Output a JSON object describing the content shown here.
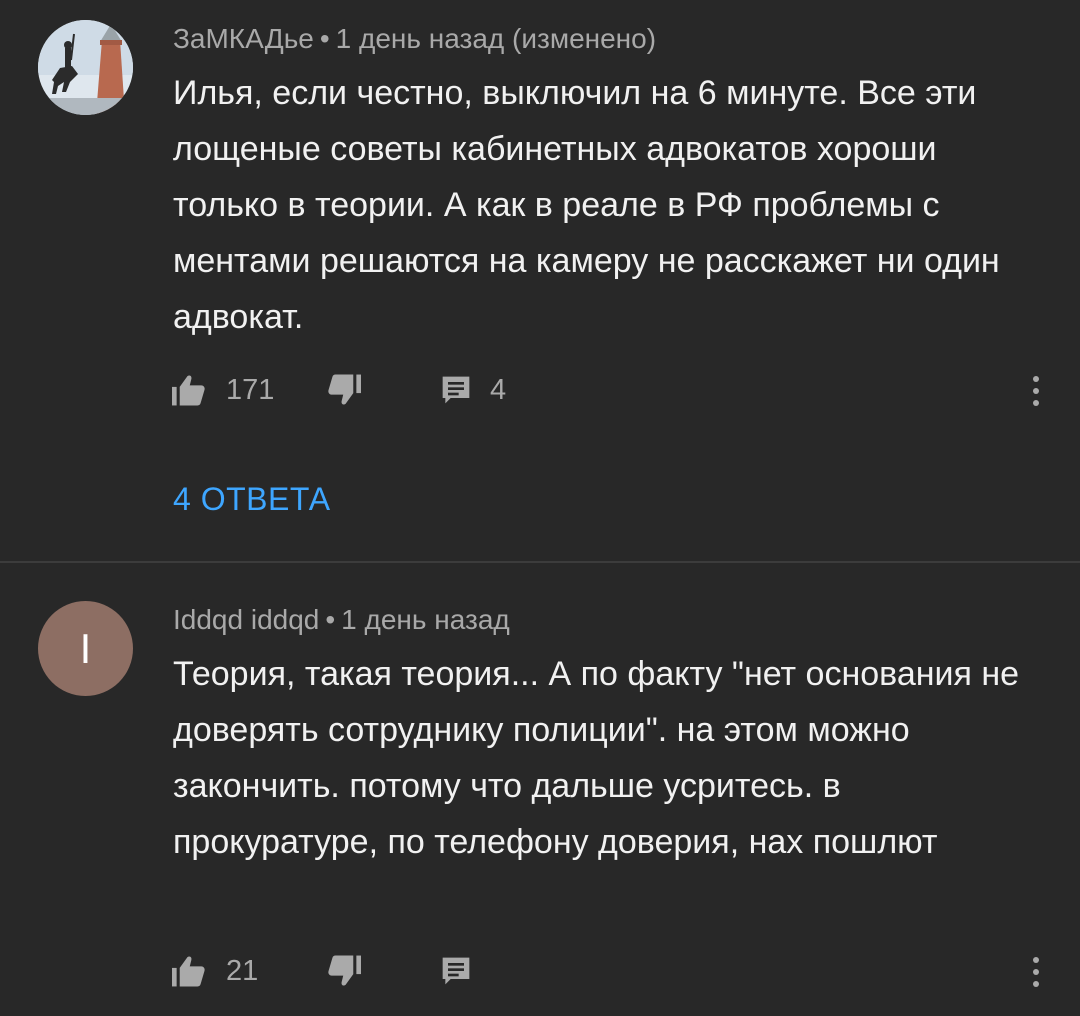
{
  "comments": [
    {
      "author": "ЗаМКАДье",
      "separator": "•",
      "time": "1 день назад (изменено)",
      "text": "Илья, если честно, выключил на 6 минуте. Все эти лощеные советы кабинетных адвокатов хороши только в теории. А как в реале в РФ проблемы с ментами решаются на камеру не расскажет ни один адвокат.",
      "likes": "171",
      "reply_count": "4",
      "replies_link": "4 ОТВЕТА",
      "avatar_icon": "monument-photo"
    },
    {
      "author": "Iddqd iddqd",
      "separator": "•",
      "time": "1 день назад",
      "text": "Теория, такая теория... А по факту \"нет основания не доверять сотруднику полиции\". на этом можно закончить. потому что дальше усритесь. в прокуратуре, по телефону доверия, нах пошлют",
      "likes": "21",
      "avatar_letter": "I",
      "avatar_color": "#8d6e63"
    }
  ],
  "icons": {
    "like": "thumbs-up-icon",
    "dislike": "thumbs-down-icon",
    "reply": "comment-reply-icon",
    "more": "more-vertical-icon"
  },
  "colors": {
    "background": "#282828",
    "link": "#3ea6ff",
    "meta": "#a9a9a9"
  }
}
